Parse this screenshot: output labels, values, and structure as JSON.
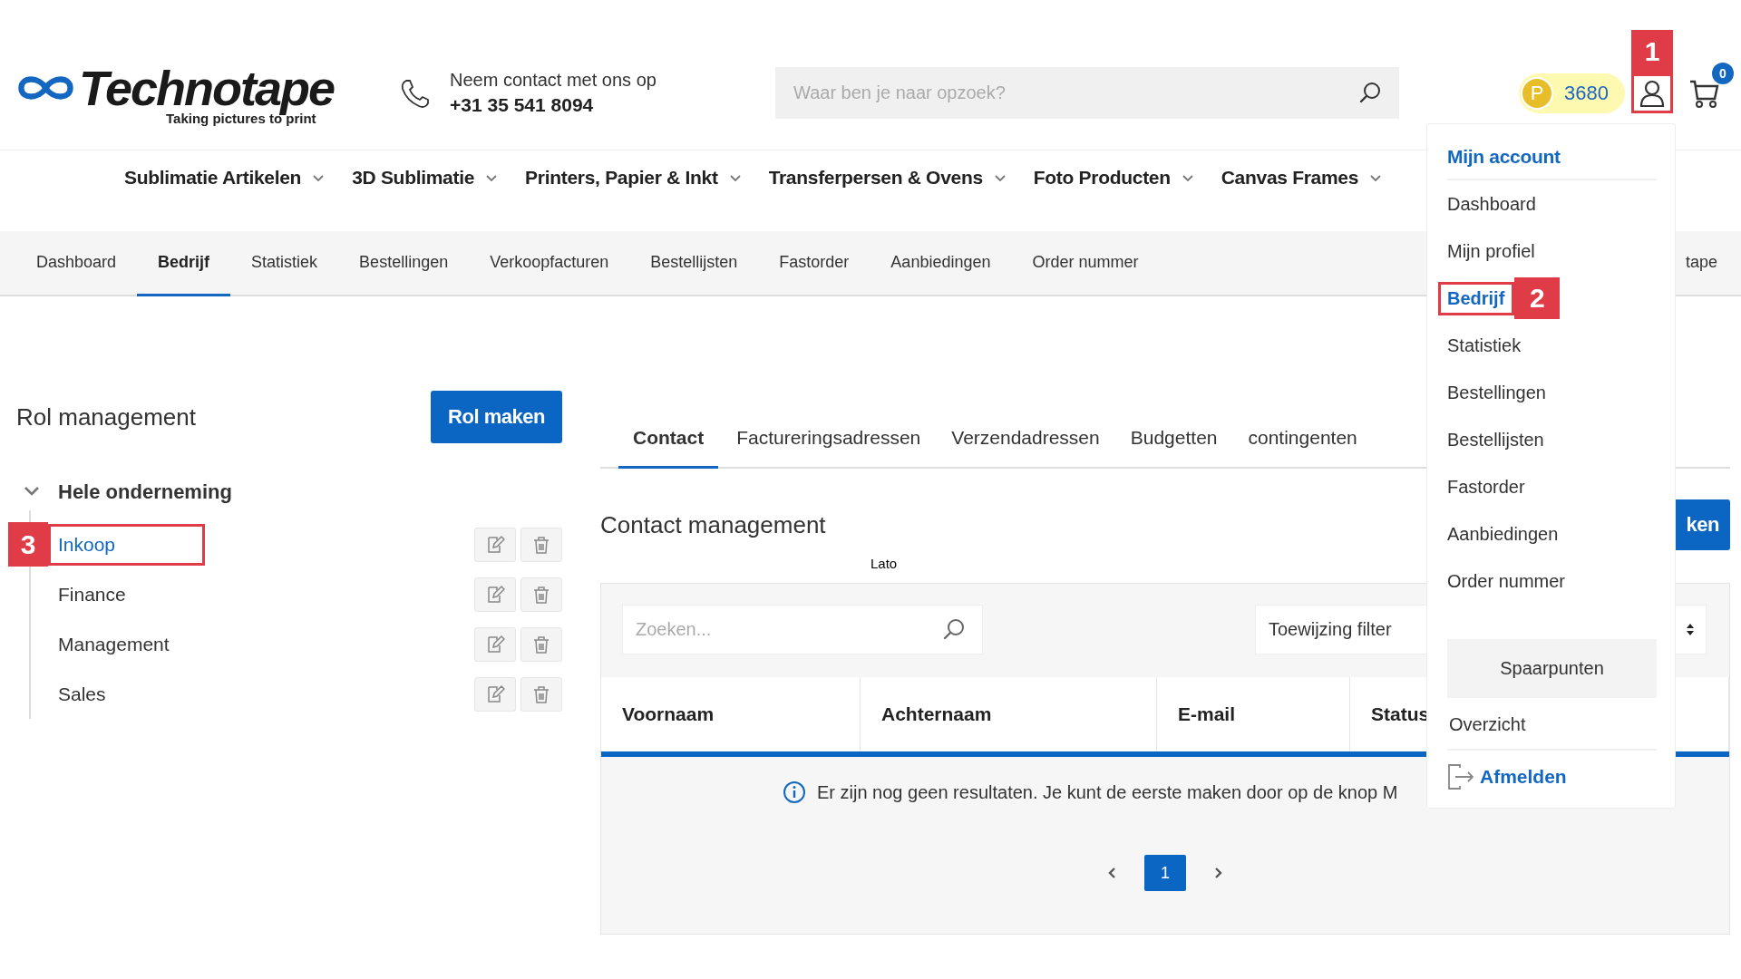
{
  "header": {
    "logo": {
      "name": "Technotape",
      "tagline": "Taking pictures to print"
    },
    "contact": {
      "line1": "Neem contact met ons op",
      "phone": "+31 35 541 8094"
    },
    "search": {
      "placeholder": "Waar ben je naar opzoek?"
    },
    "points": {
      "symbol": "P",
      "value": "3680"
    },
    "account": {
      "callout": "1"
    },
    "cart": {
      "count": "0"
    }
  },
  "nav": [
    {
      "label": "Sublimatie Artikelen"
    },
    {
      "label": "3D Sublimatie"
    },
    {
      "label": "Printers, Papier & Inkt"
    },
    {
      "label": "Transferpersen & Ovens"
    },
    {
      "label": "Foto Producten"
    },
    {
      "label": "Canvas Frames"
    }
  ],
  "subnav": [
    {
      "label": "Dashboard",
      "selected": false
    },
    {
      "label": "Bedrijf",
      "selected": true
    },
    {
      "label": "Statistiek",
      "selected": false
    },
    {
      "label": "Bestellingen",
      "selected": false
    },
    {
      "label": "Verkoopfacturen",
      "selected": false
    },
    {
      "label": "Bestellijsten",
      "selected": false
    },
    {
      "label": "Fastorder",
      "selected": false
    },
    {
      "label": "Aanbiedingen",
      "selected": false
    },
    {
      "label": "Order nummer",
      "selected": false
    },
    {
      "label": "tape",
      "selected": false
    }
  ],
  "roles": {
    "title": "Rol management",
    "button": "Rol maken",
    "tree": [
      {
        "label": "Hele onderneming",
        "expanded": true,
        "children": [
          {
            "label": "Inkoop",
            "selected": true,
            "callout": "3"
          },
          {
            "label": "Finance",
            "selected": false
          },
          {
            "label": "Management",
            "selected": false
          },
          {
            "label": "Sales",
            "selected": false
          }
        ]
      }
    ]
  },
  "company": {
    "tabs": [
      {
        "label": "Contact",
        "selected": true
      },
      {
        "label": "Factureringsadressen",
        "selected": false
      },
      {
        "label": "Verzendadressen",
        "selected": false
      },
      {
        "label": "Budgetten",
        "selected": false
      },
      {
        "label": "contingenten",
        "selected": false
      }
    ],
    "title": "Contact management",
    "button": "ken",
    "note": "Lato",
    "search": {
      "placeholder": "Zoeken..."
    },
    "filter": {
      "value": "Toewijzing filter"
    },
    "columns": [
      "Voornaam",
      "Achternaam",
      "E-mail",
      "Status"
    ],
    "empty_message": "Er zijn nog geen resultaten. Je kunt de eerste maken door op de knop M",
    "pagination": {
      "pages": [
        {
          "label": "1",
          "selected": true
        }
      ]
    }
  },
  "account_menu": {
    "title": "Mijn account",
    "items": [
      {
        "label": "Dashboard",
        "selected": false
      },
      {
        "label": "Mijn profiel",
        "selected": false
      },
      {
        "label": "Bedrijf",
        "selected": true,
        "callout": "2"
      },
      {
        "label": "Statistiek",
        "selected": false
      },
      {
        "label": "Bestellingen",
        "selected": false
      },
      {
        "label": "Bestellijsten",
        "selected": false
      },
      {
        "label": "Fastorder",
        "selected": false
      },
      {
        "label": "Aanbiedingen",
        "selected": false
      },
      {
        "label": "Order nummer",
        "selected": false
      }
    ],
    "points_section": {
      "title": "Spaarpunten",
      "items": [
        "Overzicht"
      ]
    },
    "logout": "Afmelden"
  }
}
